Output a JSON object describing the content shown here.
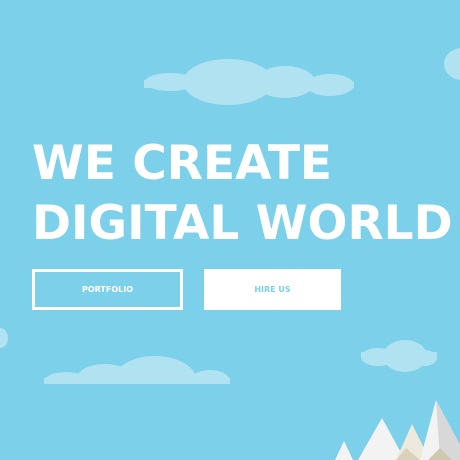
{
  "hero": {
    "line1": "WE CREATE",
    "line2": "DIGITAL WORLD"
  },
  "buttons": {
    "portfolio": "PORTFOLIO",
    "hire": "HIRE US"
  },
  "colors": {
    "sky": "#7dd0e9",
    "cloud": "#b1e2f1",
    "text": "#ffffff"
  }
}
